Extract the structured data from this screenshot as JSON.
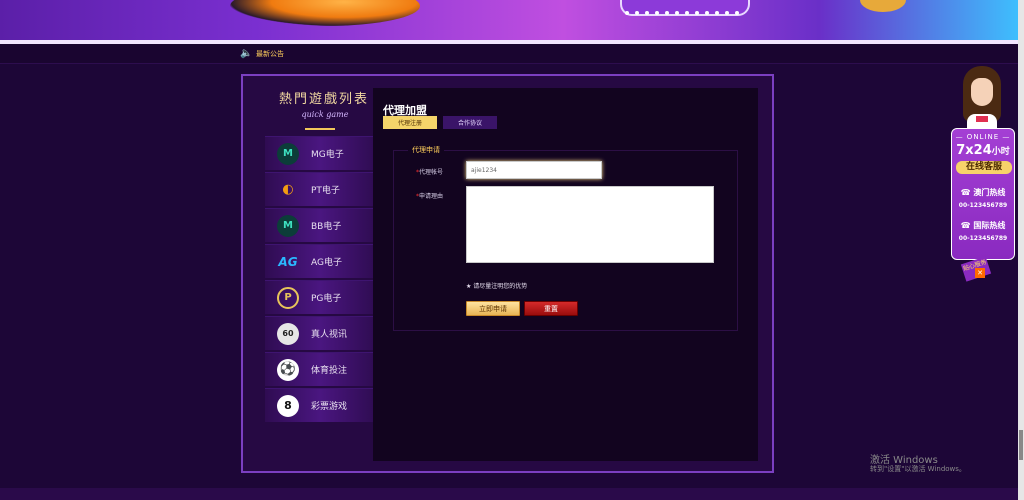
{
  "notice": {
    "icon": "speaker-icon",
    "label": "最新公告"
  },
  "sidebar": {
    "title": "熱門遊戲列表",
    "subtitle": "quick game",
    "items": [
      {
        "label": "MG电子",
        "icon": "mg-icon",
        "glyph": "M"
      },
      {
        "label": "PT电子",
        "icon": "pt-icon",
        "glyph": "◐"
      },
      {
        "label": "BB电子",
        "icon": "bb-icon",
        "glyph": "M"
      },
      {
        "label": "AG电子",
        "icon": "ag-icon",
        "glyph": "AG"
      },
      {
        "label": "PG电子",
        "icon": "pg-icon",
        "glyph": "P"
      },
      {
        "label": "真人视讯",
        "icon": "poker-chip-icon",
        "glyph": "60"
      },
      {
        "label": "体育投注",
        "icon": "soccer-ball-icon",
        "glyph": "⚽"
      },
      {
        "label": "彩票游戏",
        "icon": "lottery-ball-icon",
        "glyph": "8"
      }
    ]
  },
  "content": {
    "title": "代理加盟",
    "tabs": [
      {
        "label": "代理注册",
        "active": true
      },
      {
        "label": "合作协议",
        "active": false
      }
    ],
    "form": {
      "legend": "代理申请",
      "account_label": "代理帐号",
      "account_value": "ajie1234",
      "reason_label": "申请理由",
      "reason_value": "",
      "required_mark": "*",
      "hint": "★ 请尽量注明您的优势",
      "submit_label": "立即申请",
      "reset_label": "重置"
    }
  },
  "customer_service": {
    "online": "— ONLINE —",
    "hours": "7x24",
    "hours_unit": "小时",
    "button": "在线客服",
    "lines": [
      {
        "title": "☎ 澳门热线",
        "number": "00-123456789"
      },
      {
        "title": "☎ 国际热线",
        "number": "00-123456789"
      }
    ],
    "ribbon": "贴心服务",
    "close": "✕"
  },
  "watermark": {
    "title": "激活 Windows",
    "subtitle": "转到\"设置\"以激活 Windows。"
  },
  "colors": {
    "background": "#1d0637",
    "frame_border": "#7b3fc1",
    "accent_gold": "#f5d46a",
    "reset_red": "#c01818",
    "cs_purple": "#a43fd4"
  }
}
